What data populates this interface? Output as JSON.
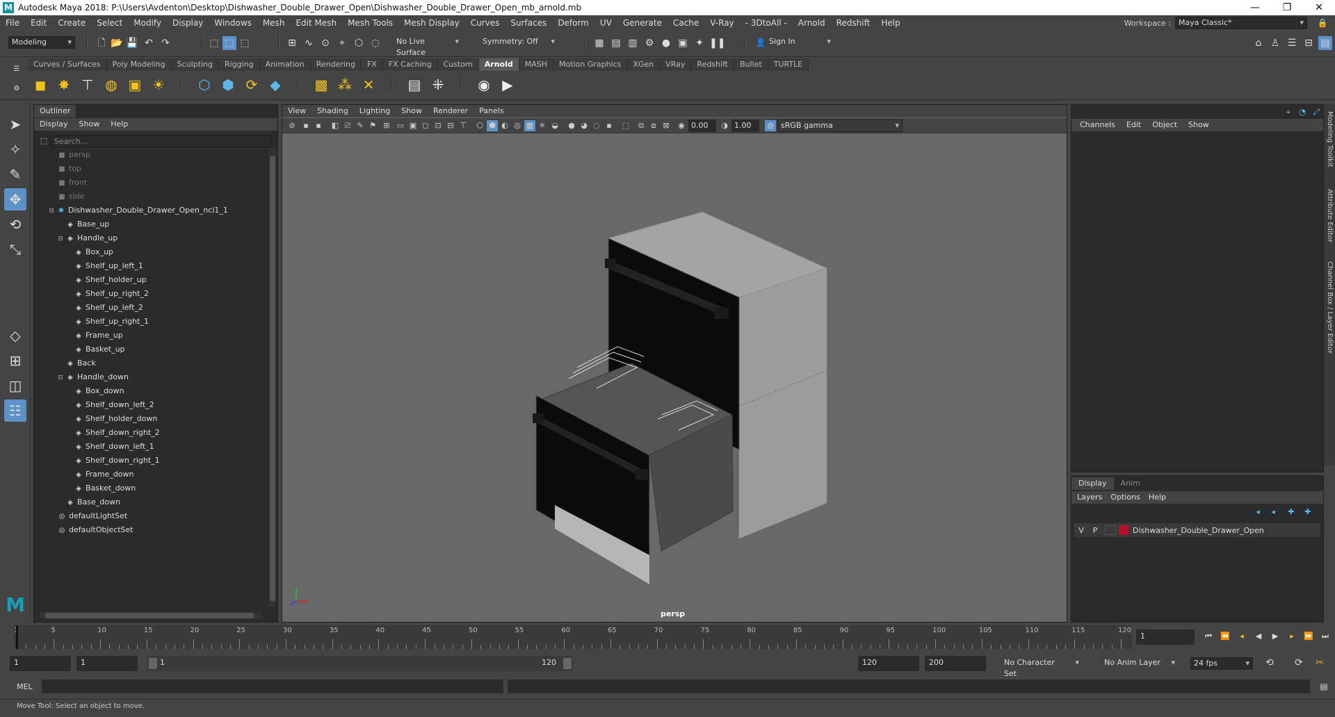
{
  "window": {
    "title": "Autodesk Maya 2018: P:\\Users\\Avdenton\\Desktop\\Dishwasher_Double_Drawer_Open\\Dishwasher_Double_Drawer_Open_mb_arnold.mb",
    "app_icon": "M"
  },
  "menubar": {
    "items": [
      "File",
      "Edit",
      "Create",
      "Select",
      "Modify",
      "Display",
      "Windows",
      "Mesh",
      "Edit Mesh",
      "Mesh Tools",
      "Mesh Display",
      "Curves",
      "Surfaces",
      "Deform",
      "UV",
      "Generate",
      "Cache",
      "V-Ray",
      "- 3DtoAll -",
      "Arnold",
      "Redshift",
      "Help"
    ],
    "workspace_label": "Workspace :",
    "workspace_value": "Maya Classic*"
  },
  "statusline": {
    "mode": "Modeling",
    "live_surface": "No Live Surface",
    "symmetry": "Symmetry: Off",
    "sign_in": "Sign In"
  },
  "shelf": {
    "tabs": [
      "Curves / Surfaces",
      "Poly Modeling",
      "Sculpting",
      "Rigging",
      "Animation",
      "Rendering",
      "FX",
      "FX Caching",
      "Custom",
      "Arnold",
      "MASH",
      "Motion Graphics",
      "XGen",
      "VRay",
      "Redshift",
      "Bullet",
      "TURTLE"
    ],
    "active_tab": "Arnold"
  },
  "outliner": {
    "tab": "Outliner",
    "menu": [
      "Display",
      "Show",
      "Help"
    ],
    "search_placeholder": "Search...",
    "items": [
      {
        "label": "persp",
        "dim": true
      },
      {
        "label": "top",
        "dim": true
      },
      {
        "label": "front",
        "dim": true
      },
      {
        "label": "side",
        "dim": true
      },
      {
        "label": "Dishwasher_Double_Drawer_Open_ncl1_1",
        "dim": false
      },
      {
        "label": "Base_up",
        "dim": false
      },
      {
        "label": "Handle_up",
        "dim": false
      },
      {
        "label": "Box_up",
        "dim": false
      },
      {
        "label": "Shelf_up_left_1",
        "dim": false
      },
      {
        "label": "Shelf_holder_up",
        "dim": false
      },
      {
        "label": "Shelf_up_right_2",
        "dim": false
      },
      {
        "label": "Shelf_up_left_2",
        "dim": false
      },
      {
        "label": "Shelf_up_right_1",
        "dim": false
      },
      {
        "label": "Frame_up",
        "dim": false
      },
      {
        "label": "Basket_up",
        "dim": false
      },
      {
        "label": "Back",
        "dim": false
      },
      {
        "label": "Handle_down",
        "dim": false
      },
      {
        "label": "Box_down",
        "dim": false
      },
      {
        "label": "Shelf_down_left_2",
        "dim": false
      },
      {
        "label": "Shelf_holder_down",
        "dim": false
      },
      {
        "label": "Shelf_down_right_2",
        "dim": false
      },
      {
        "label": "Shelf_down_left_1",
        "dim": false
      },
      {
        "label": "Shelf_down_right_1",
        "dim": false
      },
      {
        "label": "Frame_down",
        "dim": false
      },
      {
        "label": "Basket_down",
        "dim": false
      },
      {
        "label": "Base_down",
        "dim": false
      },
      {
        "label": "defaultLightSet",
        "dim": false
      },
      {
        "label": "defaultObjectSet",
        "dim": false
      }
    ]
  },
  "viewport": {
    "menu": [
      "View",
      "Shading",
      "Lighting",
      "Show",
      "Renderer",
      "Panels"
    ],
    "exposure": "0.00",
    "gamma": "1.00",
    "color_space": "sRGB gamma",
    "camera": "persp"
  },
  "channelbox": {
    "menu": [
      "Channels",
      "Edit",
      "Object",
      "Show"
    ]
  },
  "side_tabs": [
    "Modeling Toolkit",
    "Attribute Editor",
    "Channel Box / Layer Editor"
  ],
  "layer_editor": {
    "tabs": [
      "Display",
      "Anim"
    ],
    "active_tab": "Display",
    "menu": [
      "Layers",
      "Options",
      "Help"
    ],
    "layer": {
      "v": "V",
      "p": "P",
      "name": "Dishwasher_Double_Drawer_Open",
      "color": "#b0102a"
    }
  },
  "timeline": {
    "ticks": [
      1,
      5,
      10,
      15,
      20,
      25,
      30,
      35,
      40,
      45,
      50,
      55,
      60,
      65,
      70,
      75,
      80,
      85,
      90,
      95,
      100,
      105,
      110,
      115,
      120
    ],
    "current_frame": "1"
  },
  "range": {
    "start": "1",
    "playback_start": "1",
    "slider_start": "1",
    "slider_end": "120",
    "playback_end": "120",
    "end": "200",
    "character_set": "No Character Set",
    "anim_layer": "No Anim Layer",
    "fps": "24 fps"
  },
  "cmdline": {
    "label": "MEL"
  },
  "helpline": {
    "text": "Move Tool: Select an object to move."
  },
  "colors": {
    "accent": "#5d92c8",
    "maya_logo": "#14a0b8"
  }
}
